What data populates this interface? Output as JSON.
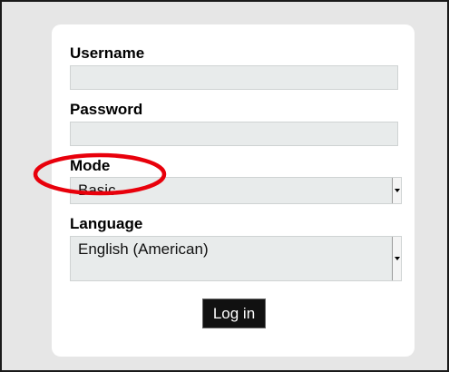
{
  "form": {
    "username_label": "Username",
    "username_value": "",
    "password_label": "Password",
    "password_value": "",
    "mode_label": "Mode",
    "mode_selected": "Basic",
    "language_label": "Language",
    "language_selected": "English (American)",
    "login_label": "Log in"
  },
  "annotation": {
    "shape": "ellipse",
    "color": "#e8000b",
    "target": "mode"
  },
  "icons": {
    "dropdown": "chevron-down-icon"
  }
}
